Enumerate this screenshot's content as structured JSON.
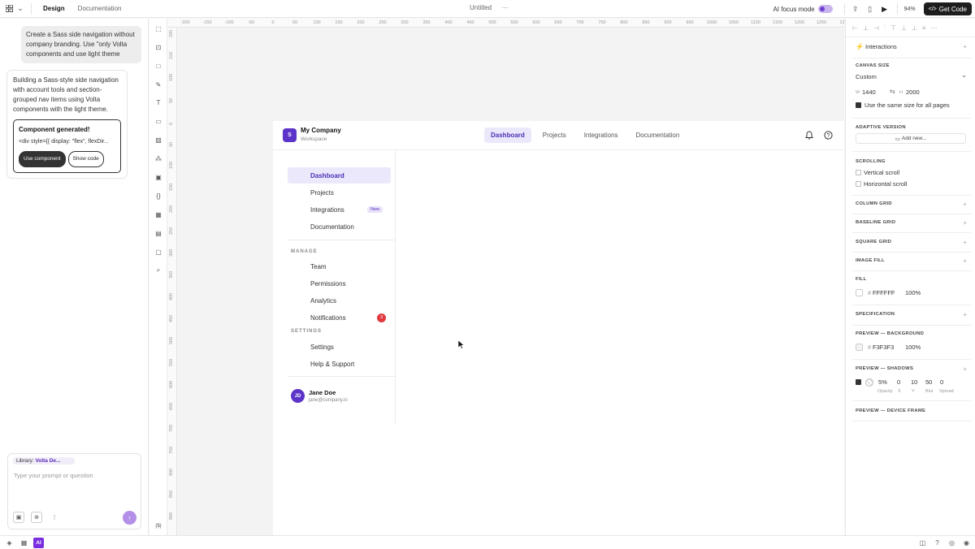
{
  "topbar": {
    "tabs": [
      "Design",
      "Documentation"
    ],
    "doc_title": "Untitled",
    "more": "···",
    "focus_mode_label": "AI focus mode",
    "zoom": "94%",
    "get_code_label": "Get Code"
  },
  "chat": {
    "user_message": "Create a Sass side navigation without company branding. Use \"only Volta components and use light theme",
    "ai_message": "Building a Sass-style side navigation with account tools and section-grouped nav items using Volta components with the light theme.",
    "card_title": "Component generated!",
    "card_code": "<div style={{ display: \"flex\", flexDir...",
    "use_component_label": "Use component",
    "show_code_label": "Show code",
    "library_label": "Library:",
    "library_value": "Volta De...",
    "prompt_placeholder": "Type your prompt or question",
    "brackets": "{$}"
  },
  "ruler_h": [
    "-200",
    "-150",
    "-100",
    "-50",
    "0",
    "50",
    "100",
    "150",
    "200",
    "250",
    "300",
    "350",
    "400",
    "450",
    "500",
    "550",
    "600",
    "650",
    "700",
    "750",
    "800",
    "850",
    "900",
    "950",
    "1000",
    "1050",
    "1100",
    "1150",
    "1200",
    "1250",
    "130"
  ],
  "ruler_v": [
    "200",
    "150",
    "100",
    "50",
    "0",
    "50",
    "100",
    "150",
    "200",
    "250",
    "300",
    "350",
    "400",
    "450",
    "500",
    "550",
    "600",
    "650",
    "700",
    "750",
    "800",
    "850",
    "900"
  ],
  "frame": {
    "logo_letter": "S",
    "company": "My Company",
    "workspace": "Workspace",
    "top_nav": [
      "Dashboard",
      "Projects",
      "Integrations",
      "Documentation"
    ],
    "side_nav": {
      "main": [
        "Dashboard",
        "Projects",
        "Integrations",
        "Documentation"
      ],
      "new_badge": "New",
      "manage_label": "MANAGE",
      "manage": [
        "Team",
        "Permissions",
        "Analytics",
        "Notifications"
      ],
      "notif_count": "3",
      "settings_label": "SETTINGS",
      "settings": [
        "Settings",
        "Help & Support"
      ]
    },
    "user": {
      "initials": "JD",
      "name": "Jane Doe",
      "email": "jane@company.io"
    }
  },
  "right_panel": {
    "interactions": "Interactions",
    "canvas_size_label": "CANVAS SIZE",
    "canvas_preset": "Custom",
    "w_label": "W",
    "w_value": "1440",
    "h_label": "H",
    "h_value": "2000",
    "same_size_label": "Use the same size for all pages",
    "adaptive_label": "ADAPTIVE VERSION",
    "add_new_label": "Add new...",
    "scrolling_label": "SCROLLING",
    "vertical_scroll": "Vertical scroll",
    "horizontal_scroll": "Horizontal scroll",
    "column_grid": "COLUMN GRID",
    "baseline_grid": "BASELINE GRID",
    "square_grid": "SQUARE GRID",
    "image_fill": "IMAGE FILL",
    "fill_label": "FILL",
    "fill_hex": "FFFFFF",
    "fill_opacity": "100%",
    "specification": "SPECIFICATION",
    "preview_bg_label": "PREVIEW — BACKGROUND",
    "bg_hex": "F3F3F3",
    "bg_opacity": "100%",
    "preview_shadows_label": "PREVIEW — SHADOWS",
    "shadow_opacity": "5%",
    "shadow_x": "0",
    "shadow_y": "10",
    "shadow_blur": "50",
    "shadow_spread": "0",
    "shadow_cols": [
      "Opacity",
      "X",
      "Y",
      "Blur",
      "Spread"
    ],
    "device_frame": "PREVIEW — DEVICE FRAME",
    "hash": "#"
  },
  "bottombar": {
    "ai_label": "AI"
  },
  "colors": {
    "accent": "#5c34c9",
    "accent_soft": "#ece8fb",
    "badge_red": "#e0393e"
  }
}
